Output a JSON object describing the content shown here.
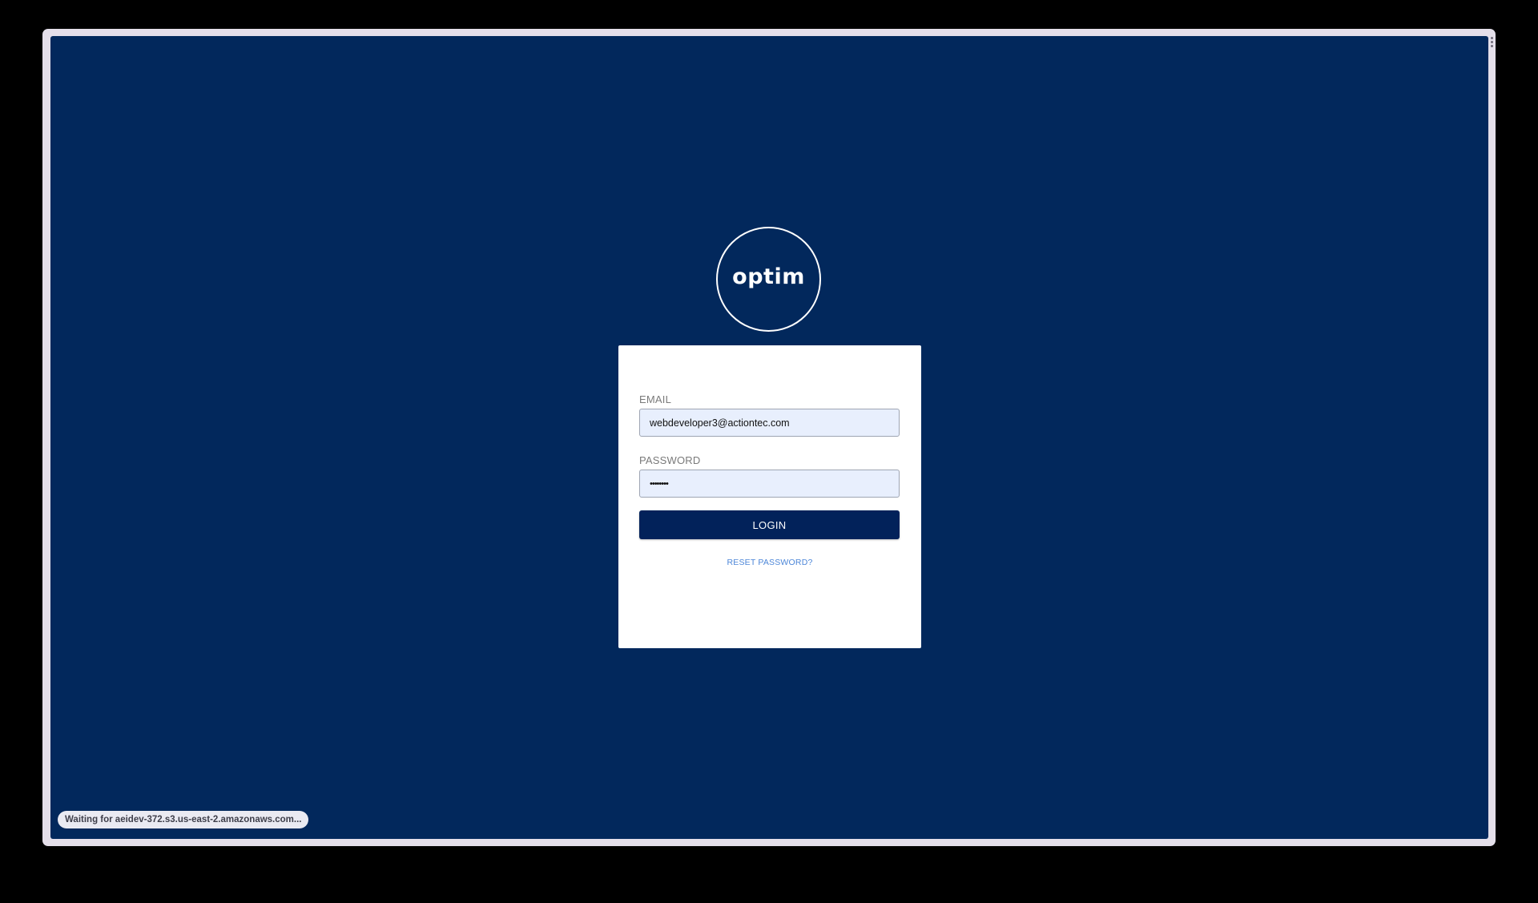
{
  "logo": {
    "text": "optim"
  },
  "login_form": {
    "email_label": "EMAIL",
    "email_value": "webdeveloper3@actiontec.com",
    "password_label": "PASSWORD",
    "password_value": "••••••••",
    "login_button_label": "LOGIN",
    "reset_password_label": "RESET PASSWORD?"
  },
  "status_bar": {
    "text": "Waiting for aeidev-372.s3.us-east-2.amazonaws.com..."
  },
  "colors": {
    "background": "#02285c",
    "button": "#02225a",
    "input_background": "#e8effd",
    "link": "#4c86d8"
  }
}
